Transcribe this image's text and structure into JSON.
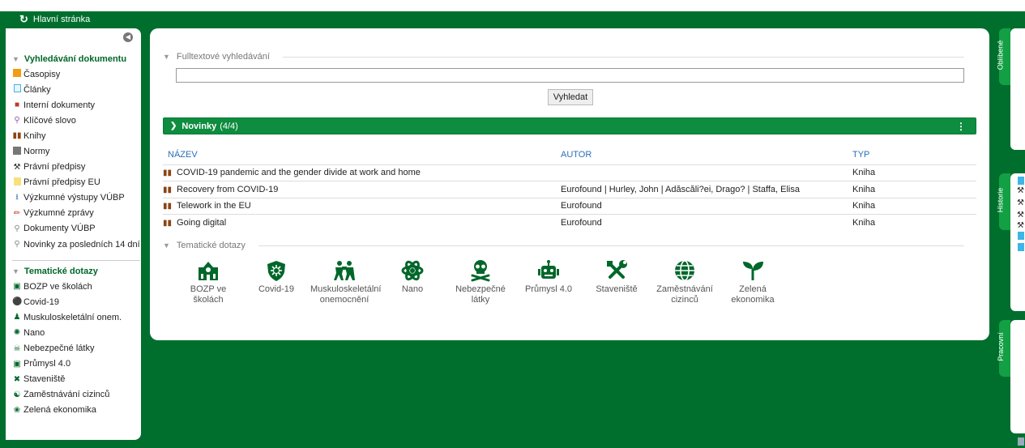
{
  "header": {
    "home_label": "Hlavní stránka"
  },
  "sidebar": {
    "section1_title": "Vyhledávání dokumentu",
    "items1": [
      {
        "label": "Časopisy",
        "icon": "magazine-icon",
        "color": "#f39c12"
      },
      {
        "label": "Články",
        "icon": "article-icon",
        "color": "#3db5e6"
      },
      {
        "label": "Interní dokumenty",
        "icon": "internal-doc-icon",
        "color": "#c0392b"
      },
      {
        "label": "Klíčové slovo",
        "icon": "key-icon",
        "color": "#9b59b6"
      },
      {
        "label": "Knihy",
        "icon": "book-icon",
        "color": "#8b4513"
      },
      {
        "label": "Normy",
        "icon": "norm-icon",
        "color": "#777777"
      },
      {
        "label": "Právní předpisy",
        "icon": "gavel-icon",
        "color": "#222222"
      },
      {
        "label": "Právní předpisy EU",
        "icon": "eu-law-icon",
        "color": "#f1c40f"
      },
      {
        "label": "Výzkumné výstupy VÚBP",
        "icon": "research-output-icon",
        "color": "#2a6fb8"
      },
      {
        "label": "Výzkumné zprávy",
        "icon": "pencil-icon",
        "color": "#c0392b"
      },
      {
        "label": "Dokumenty VÚBP",
        "icon": "search-icon",
        "color": "#7f8c8d"
      },
      {
        "label": "Novinky za posledních 14 dní",
        "icon": "search-icon",
        "color": "#7f8c8d"
      }
    ],
    "section2_title": "Tematické dotazy",
    "items2": [
      {
        "label": "BOZP ve školách",
        "icon": "school-icon"
      },
      {
        "label": "Covid-19",
        "icon": "virus-shield-icon"
      },
      {
        "label": "Muskuloskeletální onem.",
        "icon": "people-icon"
      },
      {
        "label": "Nano",
        "icon": "atom-icon"
      },
      {
        "label": "Nebezpečné látky",
        "icon": "skull-icon"
      },
      {
        "label": "Průmysl 4.0",
        "icon": "robot-icon"
      },
      {
        "label": "Staveniště",
        "icon": "tools-icon"
      },
      {
        "label": "Zaměstnávání cizinců",
        "icon": "globe-icon"
      },
      {
        "label": "Zelená ekonomika",
        "icon": "seedling-icon"
      }
    ]
  },
  "main": {
    "fulltext_label": "Fulltextové vyhledávání",
    "search_input_value": "",
    "search_button": "Vyhledat",
    "news_title": "Novinky",
    "news_count": "(4/4)",
    "columns": [
      "NÁZEV",
      "AUTOR",
      "TYP"
    ],
    "rows": [
      {
        "title": "COVID-19 pandemic and the gender divide at work and home",
        "author": "",
        "type": "Kniha"
      },
      {
        "title": "Recovery from COVID-19",
        "author": "Eurofound | Hurley, John | Adăscăli?ei, Drago? | Staffa, Elisa",
        "type": "Kniha"
      },
      {
        "title": "Telework in the EU",
        "author": "Eurofound",
        "type": "Kniha"
      },
      {
        "title": "Going digital",
        "author": "Eurofound",
        "type": "Kniha"
      }
    ],
    "topics_label": "Tematické dotazy",
    "topics": [
      {
        "line1": "BOZP ve",
        "line2": "školách",
        "icon": "school-icon"
      },
      {
        "line1": "Covid-19",
        "line2": "",
        "icon": "virus-shield-icon"
      },
      {
        "line1": "Muskuloskeletální",
        "line2": "onemocnění",
        "icon": "people-icon"
      },
      {
        "line1": "Nano",
        "line2": "",
        "icon": "atom-icon"
      },
      {
        "line1": "Nebezpečné",
        "line2": "látky",
        "icon": "skull-icon"
      },
      {
        "line1": "Průmysl 4.0",
        "line2": "",
        "icon": "robot-icon"
      },
      {
        "line1": "Staveniště",
        "line2": "",
        "icon": "tools-icon"
      },
      {
        "line1": "Zaměstnávání",
        "line2": "cizinců",
        "icon": "globe-icon"
      },
      {
        "line1": "Zelená",
        "line2": "ekonomika",
        "icon": "seedling-icon"
      }
    ]
  },
  "right_tabs": {
    "favorites": "Oblíbené",
    "history": "Historie",
    "workspace": "Pracovní"
  },
  "colors": {
    "brand_green": "#006f2e",
    "bar_green": "#0e8c3f",
    "link_blue": "#2a6fb8"
  }
}
